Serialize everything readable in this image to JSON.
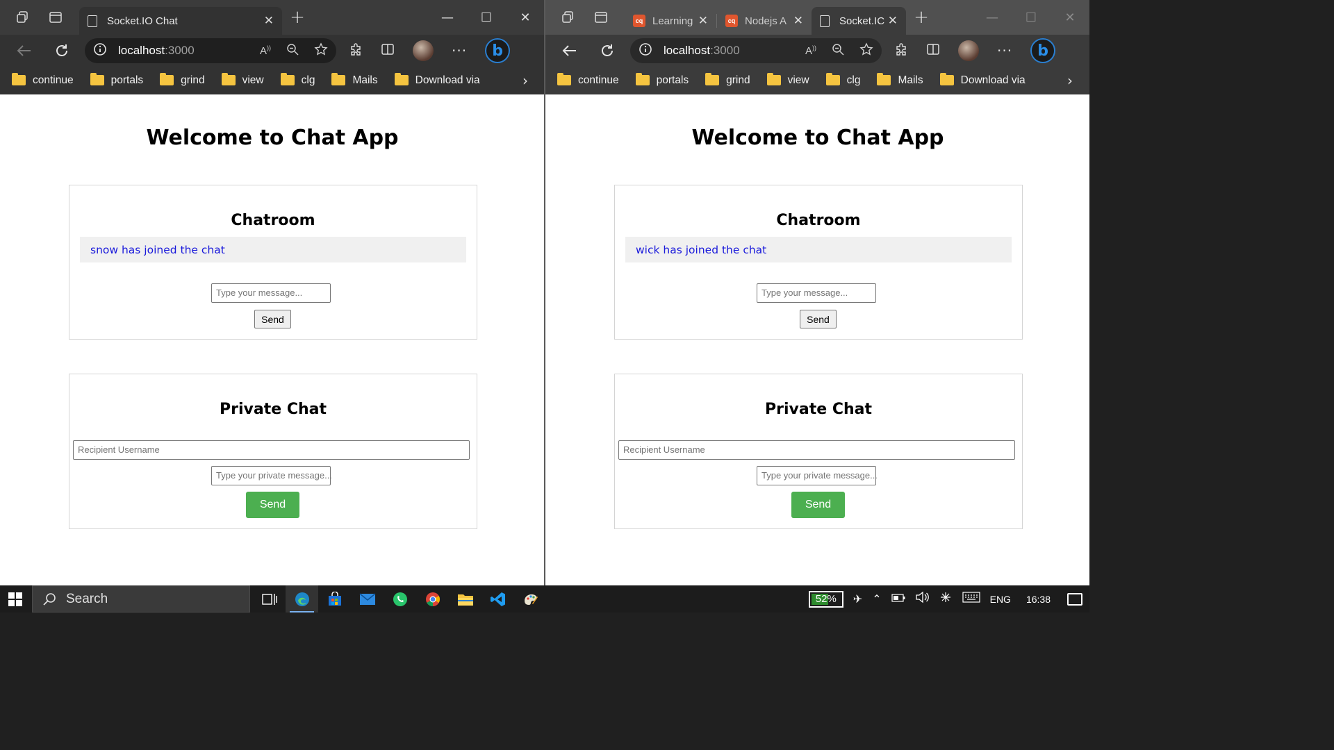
{
  "left_window": {
    "tabs": [
      {
        "title": "Socket.IO Chat",
        "active": true
      }
    ],
    "address": {
      "host": "localhost",
      "port": ":3000"
    },
    "bookmarks": [
      "continue",
      "portals",
      "grind",
      "view",
      "clg",
      "Mails",
      "Download via"
    ],
    "page": {
      "title": "Welcome to Chat App",
      "chatroom": {
        "heading": "Chatroom",
        "messages": [
          "snow has joined the chat"
        ],
        "message_placeholder": "Type your message...",
        "send_label": "Send"
      },
      "private_chat": {
        "heading": "Private Chat",
        "recipient_placeholder": "Recipient Username",
        "message_placeholder": "Type your private message...",
        "send_label": "Send"
      }
    }
  },
  "right_window": {
    "tabs": [
      {
        "title": "Learning",
        "active": false
      },
      {
        "title": "Nodejs A",
        "active": false
      },
      {
        "title": "Socket.IC",
        "active": true
      }
    ],
    "address": {
      "host": "localhost",
      "port": ":3000"
    },
    "bookmarks": [
      "continue",
      "portals",
      "grind",
      "view",
      "clg",
      "Mails",
      "Download via"
    ],
    "page": {
      "title": "Welcome to Chat App",
      "chatroom": {
        "heading": "Chatroom",
        "messages": [
          "wick has joined the chat"
        ],
        "message_placeholder": "Type your message...",
        "send_label": "Send"
      },
      "private_chat": {
        "heading": "Private Chat",
        "recipient_placeholder": "Recipient Username",
        "message_placeholder": "Type your private message...",
        "send_label": "Send"
      }
    }
  },
  "taskbar": {
    "search_label": "Search",
    "battery_percent": "52%",
    "language": "ENG",
    "time": "16:38",
    "apps": [
      "task-view",
      "edge",
      "store",
      "mail",
      "whatsapp",
      "chrome",
      "file-explorer",
      "vscode",
      "paint"
    ]
  },
  "colors": {
    "send_green": "#4caf50",
    "join_message_blue": "#1a1adb",
    "tabbar_dark": "#3b3b3b"
  }
}
